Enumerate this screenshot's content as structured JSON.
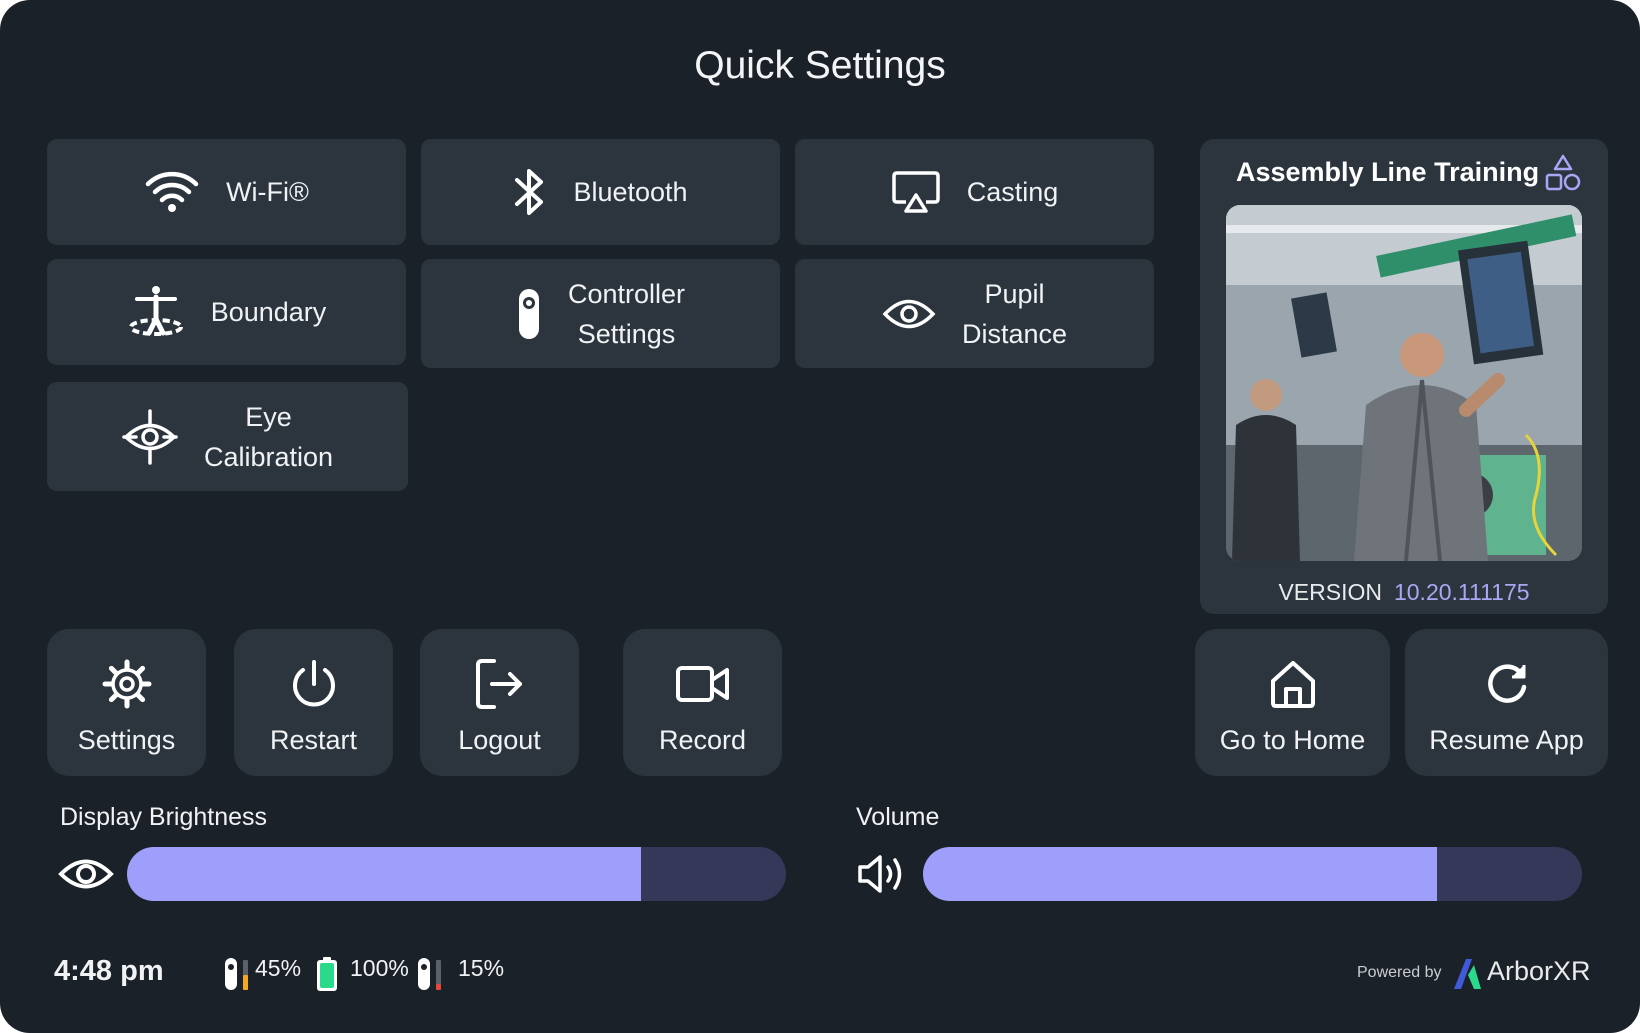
{
  "title": "Quick Settings",
  "tiles": {
    "wifi": "Wi-Fi®",
    "bluetooth": "Bluetooth",
    "casting": "Casting",
    "boundary": "Boundary",
    "controller_line1": "Controller",
    "controller_line2": "Settings",
    "pupil_line1": "Pupil",
    "pupil_line2": "Distance",
    "eye_line1": "Eye",
    "eye_line2": "Calibration"
  },
  "app_card": {
    "title": "Assembly Line Training",
    "version_label": "VERSION",
    "version_number": "10.20.111175",
    "icon": "shapes-icon"
  },
  "actions": {
    "settings": "Settings",
    "restart": "Restart",
    "logout": "Logout",
    "record": "Record",
    "home": "Go to Home",
    "resume": "Resume App"
  },
  "sliders": {
    "brightness": {
      "label": "Display Brightness",
      "value_fraction": 0.78,
      "icon": "eye-icon"
    },
    "volume": {
      "label": "Volume",
      "value_fraction": 0.78,
      "icon": "speaker-icon"
    }
  },
  "status": {
    "time": "4:48 pm",
    "left_controller": "45%",
    "headset": "100%",
    "right_controller": "15%",
    "powered_by": "Powered by",
    "brand": "ArborXR"
  },
  "colors": {
    "accent": "#9d9ffa",
    "track": "#363859",
    "background": "#1b2128",
    "tile": "#2c353e",
    "battery_green": "#2bd98a",
    "battery_orange": "#f5a623",
    "battery_red": "#e8453c"
  }
}
